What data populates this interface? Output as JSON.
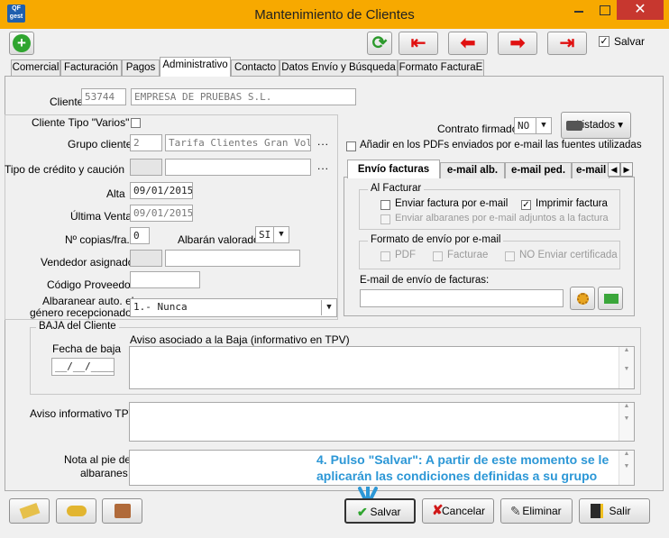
{
  "window": {
    "title": "Mantenimiento de Clientes",
    "app_badge": "QF gest",
    "close_glyph": "✕"
  },
  "toolbar": {
    "add_glyph": "+",
    "refresh_glyph": "⟳",
    "nav_first": "⇤",
    "nav_prev": "⬅",
    "nav_next": "➡",
    "nav_last": "⇥",
    "salvar_checkbox_label": "Salvar",
    "salvar_checked": "✓"
  },
  "tabs": [
    "Comercial",
    "Facturación",
    "Pagos",
    "Administrativo",
    "Contacto",
    "Datos Envío y Búsqueda",
    "Formato FacturaE"
  ],
  "cliente": {
    "label": "Cliente",
    "code": "53744",
    "name": "EMPRESA DE PRUEBAS S.L."
  },
  "form": {
    "tipo_varios_label": "Cliente Tipo \"Varios\"",
    "grupo_label": "Grupo cliente",
    "grupo_code": "2",
    "grupo_name": "Tarifa Clientes Gran Volum",
    "credito_label": "Tipo de crédito y caución",
    "alta_label": "Alta",
    "alta_value": "09/01/2015",
    "ultima_label": "Última Venta",
    "ultima_value": "09/01/2015",
    "copias_label": "Nº copias/fra.",
    "copias_value": "0",
    "albaran_valorado_label": "Albarán valorado",
    "albaran_valorado_value": "SI",
    "vendedor_label": "Vendedor asignado",
    "proveedor_label": "Código Proveedor",
    "albaranear_label_1": "Albaranear auto. el",
    "albaranear_label_2": "género recepcionado:",
    "albaranear_value": "1.- Nunca",
    "dots": "..."
  },
  "right": {
    "contrato_label": "Contrato firmado",
    "contrato_value": "NO",
    "listados_label": "Listados",
    "anadir_pdf_label": "Añadir en los PDFs enviados por e-mail las fuentes utilizadas",
    "subtabs": [
      "Envío facturas",
      "e-mail alb.",
      "e-mail ped.",
      "e-mail"
    ],
    "al_facturar_title": "Al Facturar",
    "enviar_factura": "Enviar factura por e-mail",
    "imprimir_factura": "Imprimir factura",
    "imprimir_checked": "✓",
    "enviar_albaranes": "Enviar albaranes por e-mail adjuntos a la factura",
    "formato_title": "Formato de envío por e-mail",
    "pdf": "PDF",
    "facturae": "Facturae",
    "no_enviar": "NO Enviar certificada",
    "email_label": "E-mail de envío de facturas:"
  },
  "baja": {
    "title": "BAJA del Cliente",
    "fecha_label": "Fecha de baja",
    "fecha_value": "__/__/____",
    "aviso_label": "Aviso asociado a la Baja (informativo en TPV)"
  },
  "aviso_tpv_label": "Aviso informativo TPV",
  "nota_label_1": "Nota al pie de",
  "nota_label_2": "albaranes",
  "annotation": {
    "line1": "4. Pulso \"Salvar\": A partir de este momento se le",
    "line2": "aplicarán las condiciones definidas a su grupo"
  },
  "buttons": {
    "salvar": "Salvar",
    "cancelar": "Cancelar",
    "eliminar": "Eliminar",
    "salir": "Salir"
  },
  "colors": {
    "titlebar": "#f7a900",
    "close": "#c7372f",
    "annotation": "#2c97d6",
    "nav_arrow": "#e01010",
    "add_green": "#2fa52f"
  }
}
